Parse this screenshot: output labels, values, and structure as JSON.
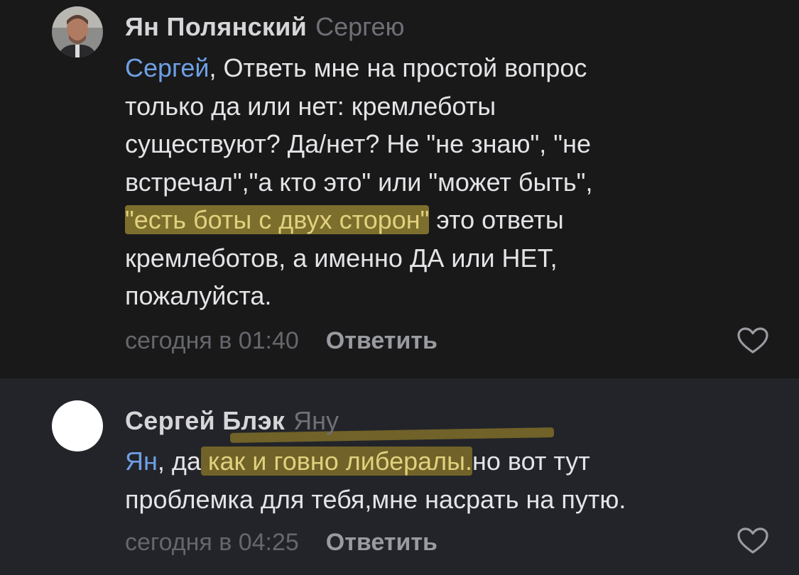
{
  "comments": [
    {
      "author": "Ян Полянский",
      "reply_to": "Сергею",
      "mention": "Сергей",
      "text_before_highlight": ", Ответь мне на простой вопрос\nтолько да или нет: кремлеботы\nсуществуют? Да/нет?  Не \"не знаю\", \"не\nвстречал\",\"а кто это\" или \"может быть\",\n",
      "highlight": "\"есть боты с двух сторон\"",
      "text_after_highlight": " это ответы\nкремлеботов, а именно ДА или НЕТ,\nпожалуйста.",
      "time": "сегодня в 01:40",
      "reply_label": "Ответить",
      "like_icon": "heart-outline-icon"
    },
    {
      "author": "Сергей Блэк",
      "reply_to": "Яну",
      "mention": "Ян",
      "text_before_highlight": ", да",
      "highlight": " как и говно либералы.",
      "text_after_highlight": "но вот тут\nпроблемка для тебя,мне насрать на путю.",
      "time": "сегодня в 04:25",
      "reply_label": "Ответить",
      "like_icon": "heart-outline-icon"
    }
  ],
  "colors": {
    "background_top": "#19191a",
    "background_bottom": "#232429",
    "mention": "#6ea0e4",
    "highlight": "#cdb43c",
    "text": "#e4e4e7",
    "muted": "#66676c"
  }
}
